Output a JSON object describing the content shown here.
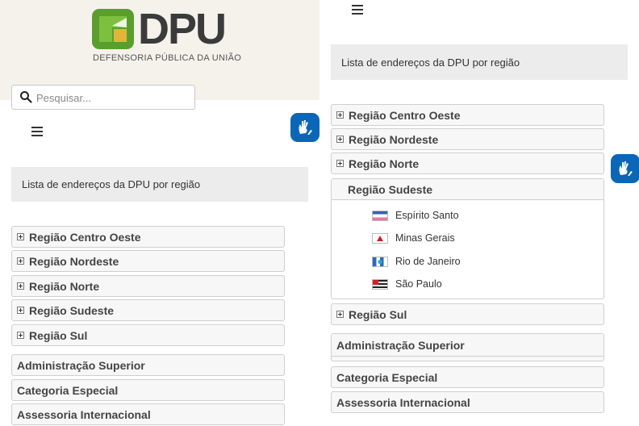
{
  "logo": {
    "wordmark": "DPU",
    "tagline": "DEFENSORIA PÚBLICA DA UNIÃO"
  },
  "search": {
    "placeholder": "Pesquisar..."
  },
  "page_heading": "Lista de endereços da DPU por região",
  "left_accordion": [
    {
      "label": "Região Centro Oeste"
    },
    {
      "label": "Região Nordeste"
    },
    {
      "label": "Região Norte"
    },
    {
      "label": "Região Sudeste"
    },
    {
      "label": "Região Sul"
    }
  ],
  "sections": [
    {
      "label": "Administração Superior"
    },
    {
      "label": "Categoria Especial"
    },
    {
      "label": "Assessoria Internacional"
    }
  ],
  "right_accordion": {
    "collapsed_before": [
      {
        "label": "Região Centro Oeste"
      },
      {
        "label": "Região Nordeste"
      },
      {
        "label": "Região Norte"
      }
    ],
    "expanded": {
      "label": "Região Sudeste",
      "states": [
        {
          "name": "Espírito Santo",
          "flag": "espirito-santo-flag"
        },
        {
          "name": "Minas Gerais",
          "flag": "minas-gerais-flag"
        },
        {
          "name": "Rio de Janeiro",
          "flag": "rio-de-janeiro-flag"
        },
        {
          "name": "São Paulo",
          "flag": "sao-paulo-flag"
        }
      ]
    },
    "collapsed_after": [
      {
        "label": "Região Sul"
      }
    ]
  },
  "colors": {
    "header_band": "#f5f2ec",
    "title_box": "#ececec",
    "vlibras": "#0a66b7",
    "logo_green": "#5a9f2d",
    "logo_gold": "#e3b43a"
  },
  "icons": {
    "search": "search-icon",
    "menu": "hamburger-menu-icon",
    "accessibility": "vlibras-hands-icon",
    "expand": "plus-square-icon"
  }
}
